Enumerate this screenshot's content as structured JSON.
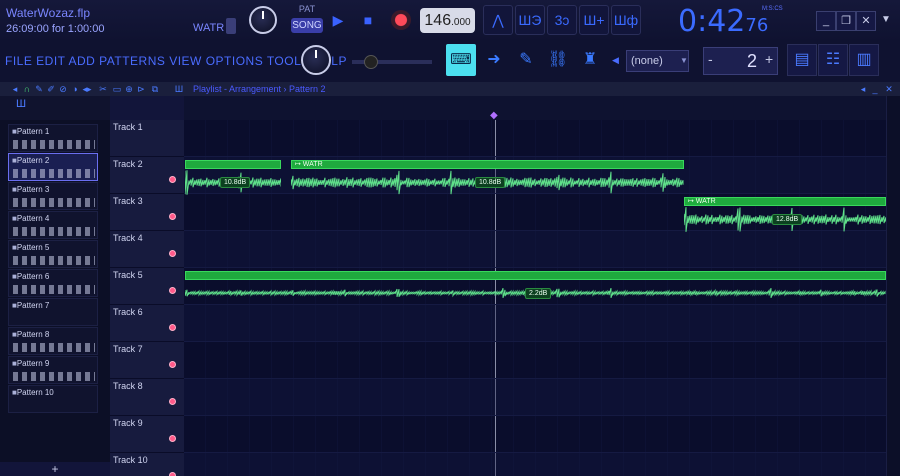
{
  "project": {
    "filename": "WaterWozaz.flp",
    "time_info": "26:09:00 for 1:00:00",
    "hint": "WATR"
  },
  "transport": {
    "pat_label": "PAT",
    "song_label": "SONG",
    "tempo": "146",
    "tempo_decimal": ".000"
  },
  "clock": {
    "main": "0:42",
    "sub": "76",
    "label": "M:S:CS"
  },
  "menu": {
    "text": "FILE EDIT ADD PATTERNS VIEW OPTIONS TOOLS HELP"
  },
  "toolbar": {
    "pattern_select": "(none)",
    "stepper_value": "2",
    "stepper_plus": "+",
    "stepper_minus": "-"
  },
  "playlist": {
    "title": "Playlist - Arrangement › Pattern 2"
  },
  "patterns": [
    "Pattern 1",
    "Pattern 2",
    "Pattern 3",
    "Pattern 4",
    "Pattern 5",
    "Pattern 6",
    "Pattern 7",
    "Pattern 8",
    "Pattern 9",
    "Pattern 10"
  ],
  "picker_add": "+",
  "tracks": [
    "Track 1",
    "Track 2",
    "Track 3",
    "Track 4",
    "Track 5",
    "Track 6",
    "Track 7",
    "Track 8",
    "Track 9",
    "Track 10"
  ],
  "clips": [
    {
      "track": "Track 2",
      "label": "",
      "gain": "10.8dB"
    },
    {
      "track": "Track 2",
      "label": "↦ WATR",
      "gain": "10.8dB"
    },
    {
      "track": "Track 3",
      "label": "↦ WATR",
      "gain": "12.8dB"
    },
    {
      "track": "Track 5",
      "label": "",
      "gain": "2.2dB"
    }
  ],
  "colors": {
    "accent": "#3b6bff",
    "clip_green": "#1faa3e",
    "wave": "#5fe08a",
    "background": "#0a0c28"
  }
}
